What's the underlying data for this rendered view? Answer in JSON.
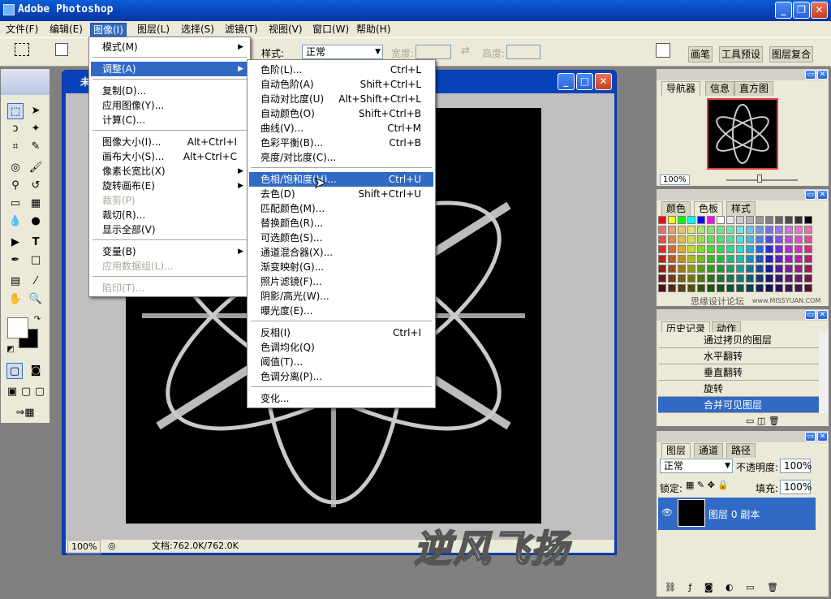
{
  "app": {
    "title": "Adobe Photoshop",
    "close": "✕",
    "max": "❐",
    "min": "_"
  },
  "menubar": [
    {
      "label": "文件(F)"
    },
    {
      "label": "编辑(E)"
    },
    {
      "label": "图像(I)"
    },
    {
      "label": "图层(L)"
    },
    {
      "label": "选择(S)"
    },
    {
      "label": "滤镜(T)"
    },
    {
      "label": "视图(V)"
    },
    {
      "label": "窗口(W)"
    },
    {
      "label": "帮助(H)"
    }
  ],
  "options": {
    "style_label": "样式:",
    "style_value": "正常",
    "width_label": "宽度:",
    "height_label": "高度:",
    "panel_tabs": [
      "画笔",
      "工具预设",
      "图层复合"
    ]
  },
  "image_menu": [
    {
      "label": "模式(M)",
      "sub": true
    },
    {
      "label": "调整(A)",
      "sub": true,
      "highlight": true
    },
    {
      "label": "复制(D)..."
    },
    {
      "label": "应用图像(Y)..."
    },
    {
      "label": "计算(C)..."
    },
    {
      "label": "图像大小(I)...",
      "shortcut": "Alt+Ctrl+I"
    },
    {
      "label": "画布大小(S)...",
      "shortcut": "Alt+Ctrl+C"
    },
    {
      "label": "像素长宽比(X)",
      "sub": true
    },
    {
      "label": "旋转画布(E)",
      "sub": true
    },
    {
      "label": "裁剪(P)",
      "disabled": true
    },
    {
      "label": "裁切(R)..."
    },
    {
      "label": "显示全部(V)"
    },
    {
      "label": "变量(B)",
      "sub": true
    },
    {
      "label": "应用数据组(L)...",
      "disabled": true
    },
    {
      "label": "陷印(T)...",
      "disabled": true
    }
  ],
  "adjust_menu": [
    {
      "label": "色阶(L)...",
      "shortcut": "Ctrl+L"
    },
    {
      "label": "自动色阶(A)",
      "shortcut": "Shift+Ctrl+L"
    },
    {
      "label": "自动对比度(U)",
      "shortcut": "Alt+Shift+Ctrl+L"
    },
    {
      "label": "自动颜色(O)",
      "shortcut": "Shift+Ctrl+B"
    },
    {
      "label": "曲线(V)...",
      "shortcut": "Ctrl+M"
    },
    {
      "label": "色彩平衡(B)...",
      "shortcut": "Ctrl+B"
    },
    {
      "label": "亮度/对比度(C)..."
    },
    {
      "label": "色相/饱和度(H)...",
      "shortcut": "Ctrl+U",
      "highlight": true
    },
    {
      "label": "去色(D)",
      "shortcut": "Shift+Ctrl+U"
    },
    {
      "label": "匹配颜色(M)..."
    },
    {
      "label": "替换颜色(R)..."
    },
    {
      "label": "可选颜色(S)..."
    },
    {
      "label": "通道混合器(X)..."
    },
    {
      "label": "渐变映射(G)..."
    },
    {
      "label": "照片滤镜(F)..."
    },
    {
      "label": "阴影/高光(W)..."
    },
    {
      "label": "曝光度(E)..."
    },
    {
      "label": "反相(I)",
      "shortcut": "Ctrl+I"
    },
    {
      "label": "色调均化(Q)"
    },
    {
      "label": "阈值(T)..."
    },
    {
      "label": "色调分离(P)..."
    },
    {
      "label": "变化..."
    }
  ],
  "document": {
    "title": "未",
    "zoom": "100%",
    "status": "文档:762.0K/762.0K"
  },
  "navigator": {
    "tabs": [
      "导航器",
      "信息",
      "直方图"
    ],
    "zoom": "100%"
  },
  "color_panel": {
    "tabs": [
      "颜色",
      "色板",
      "样式"
    ],
    "footer": "思缘设计论坛",
    "footer_url": "www.MISSYUAN.COM"
  },
  "history": {
    "tabs": [
      "历史记录",
      "动作"
    ],
    "items": [
      "通过拷贝的图层",
      "水平翻转",
      "垂直翻转",
      "旋转",
      "合并可见图层"
    ],
    "selected_index": 4
  },
  "layers": {
    "tabs": [
      "图层",
      "通道",
      "路径"
    ],
    "blend": "正常",
    "opacity_label": "不透明度:",
    "opacity": "100%",
    "lock_label": "锁定:",
    "fill_label": "填充:",
    "fill": "100%",
    "layer_name": "图层 0 副本"
  },
  "watermark": "逆风飞扬"
}
